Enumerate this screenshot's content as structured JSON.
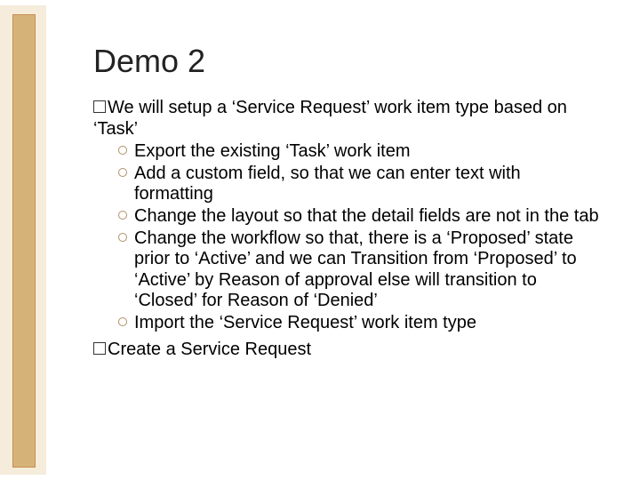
{
  "title": "Demo 2",
  "items": [
    {
      "text": "We will setup a ‘Service Request’ work item type based on ‘Task’",
      "sub": [
        "Export the existing ‘Task’ work item",
        "Add a custom field, so that we can enter text with formatting",
        "Change the layout so that the detail fields are not in the tab",
        "Change the workflow so that, there is a ‘Proposed’ state prior to ‘Active’ and we can Transition from ‘Proposed’ to ‘Active’ by Reason of approval else will transition to ‘Closed’ for Reason of ‘Denied’",
        "Import the ‘Service Request’ work item type"
      ]
    },
    {
      "text": "Create a Service Request",
      "sub": []
    }
  ]
}
